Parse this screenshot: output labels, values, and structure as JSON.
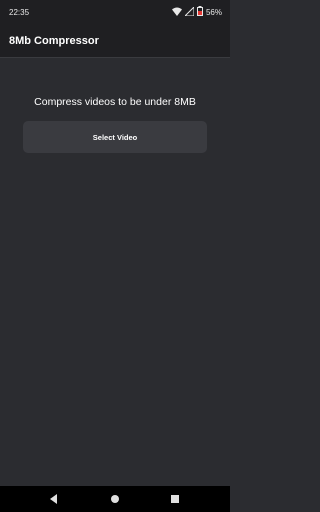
{
  "status_bar": {
    "time": "22:35",
    "battery_text": "56%",
    "icons": [
      "wifi-icon",
      "signal-icon",
      "battery-icon"
    ],
    "battery_color": "#e53935"
  },
  "app_bar": {
    "title": "8Mb Compressor"
  },
  "main": {
    "headline": "Compress videos to be under 8MB",
    "select_button_label": "Select Video"
  },
  "navigation": {
    "buttons": [
      "back-icon",
      "home-icon",
      "recents-icon"
    ]
  },
  "colors": {
    "background": "#2b2c30",
    "bars": "#1f1f22",
    "button": "#3a3b40",
    "text": "#ffffff"
  }
}
